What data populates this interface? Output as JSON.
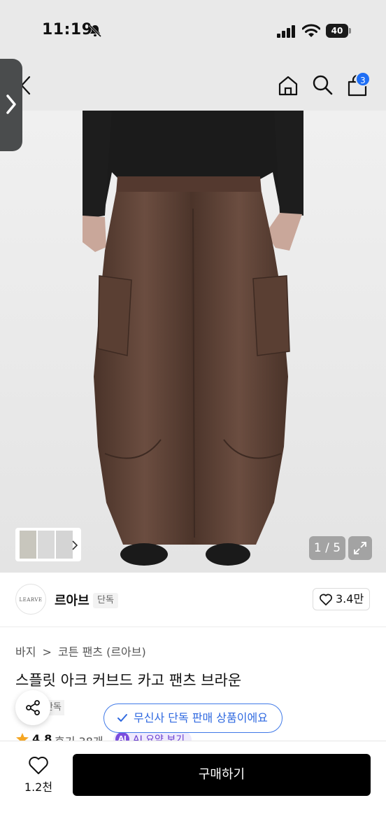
{
  "status_bar": {
    "time": "11:19",
    "battery": "40"
  },
  "header": {
    "cart_count": "3",
    "icons": [
      "back-icon",
      "home-icon",
      "search-icon",
      "cart-icon"
    ]
  },
  "gallery": {
    "counter": "1 / 5",
    "current_image": 1,
    "total_images": 5
  },
  "brand": {
    "logo_text": "LEARVE",
    "name": "르아브",
    "tag": "단독",
    "likes": "3.4만"
  },
  "product": {
    "breadcrumb": [
      "바지",
      "코튼 팬츠 (르아브)"
    ],
    "breadcrumb_separator": ">",
    "title": "스플릿 아크 커브드 카고 팬츠 브라운",
    "exclusive_tag": "단독",
    "exclusive_banner": "무신사 단독 판매 상품이에요",
    "rating": "4.8",
    "reviews": "후기 38개",
    "ai_badge": "AI",
    "ai_summary": "AI 요약 보기"
  },
  "bottom_bar": {
    "wish_count": "1.2천",
    "buy_label": "구매하기"
  },
  "colors": {
    "accent_blue": "#2f69e0",
    "badge_blue": "#1e6ef5",
    "ai_purple": "#7b4dde",
    "buy_button": "#000000",
    "rating_star": "#f5a623"
  }
}
